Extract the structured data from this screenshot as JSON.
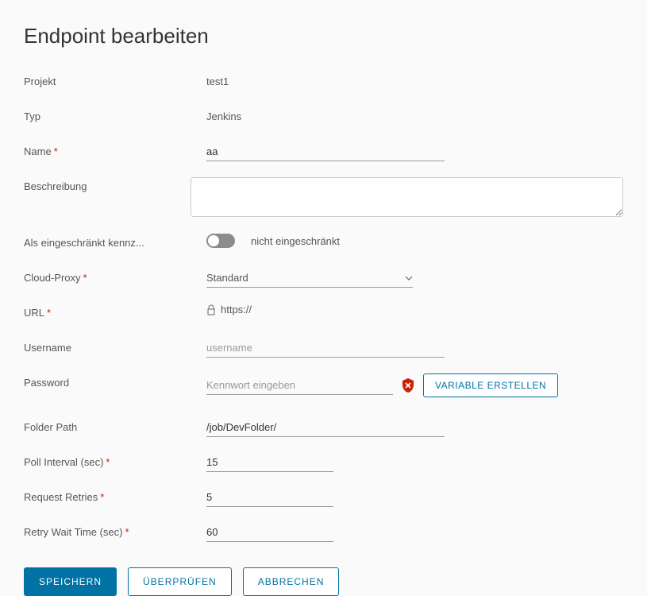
{
  "title": "Endpoint bearbeiten",
  "fields": {
    "project": {
      "label": "Projekt",
      "value": "test1"
    },
    "type": {
      "label": "Typ",
      "value": "Jenkins"
    },
    "name": {
      "label": "Name",
      "value": "aa"
    },
    "description": {
      "label": "Beschreibung",
      "value": ""
    },
    "restricted": {
      "label": "Als eingeschränkt kennz...",
      "status": "nicht eingeschränkt"
    },
    "cloudproxy": {
      "label": "Cloud-Proxy",
      "value": "Standard"
    },
    "url": {
      "label": "URL",
      "prefix": "https://"
    },
    "username": {
      "label": "Username",
      "placeholder": "username",
      "value": ""
    },
    "password": {
      "label": "Password",
      "placeholder": "Kennwort eingeben",
      "value": "",
      "variable_button": "VARIABLE ERSTELLEN"
    },
    "folderpath": {
      "label": "Folder Path",
      "value": "/job/DevFolder/"
    },
    "pollinterval": {
      "label": "Poll Interval (sec)",
      "value": "15"
    },
    "retries": {
      "label": "Request Retries",
      "value": "5"
    },
    "retrywait": {
      "label": "Retry Wait Time (sec)",
      "value": "60"
    }
  },
  "buttons": {
    "save": "SPEICHERN",
    "validate": "ÜBERPRÜFEN",
    "cancel": "ABBRECHEN"
  }
}
